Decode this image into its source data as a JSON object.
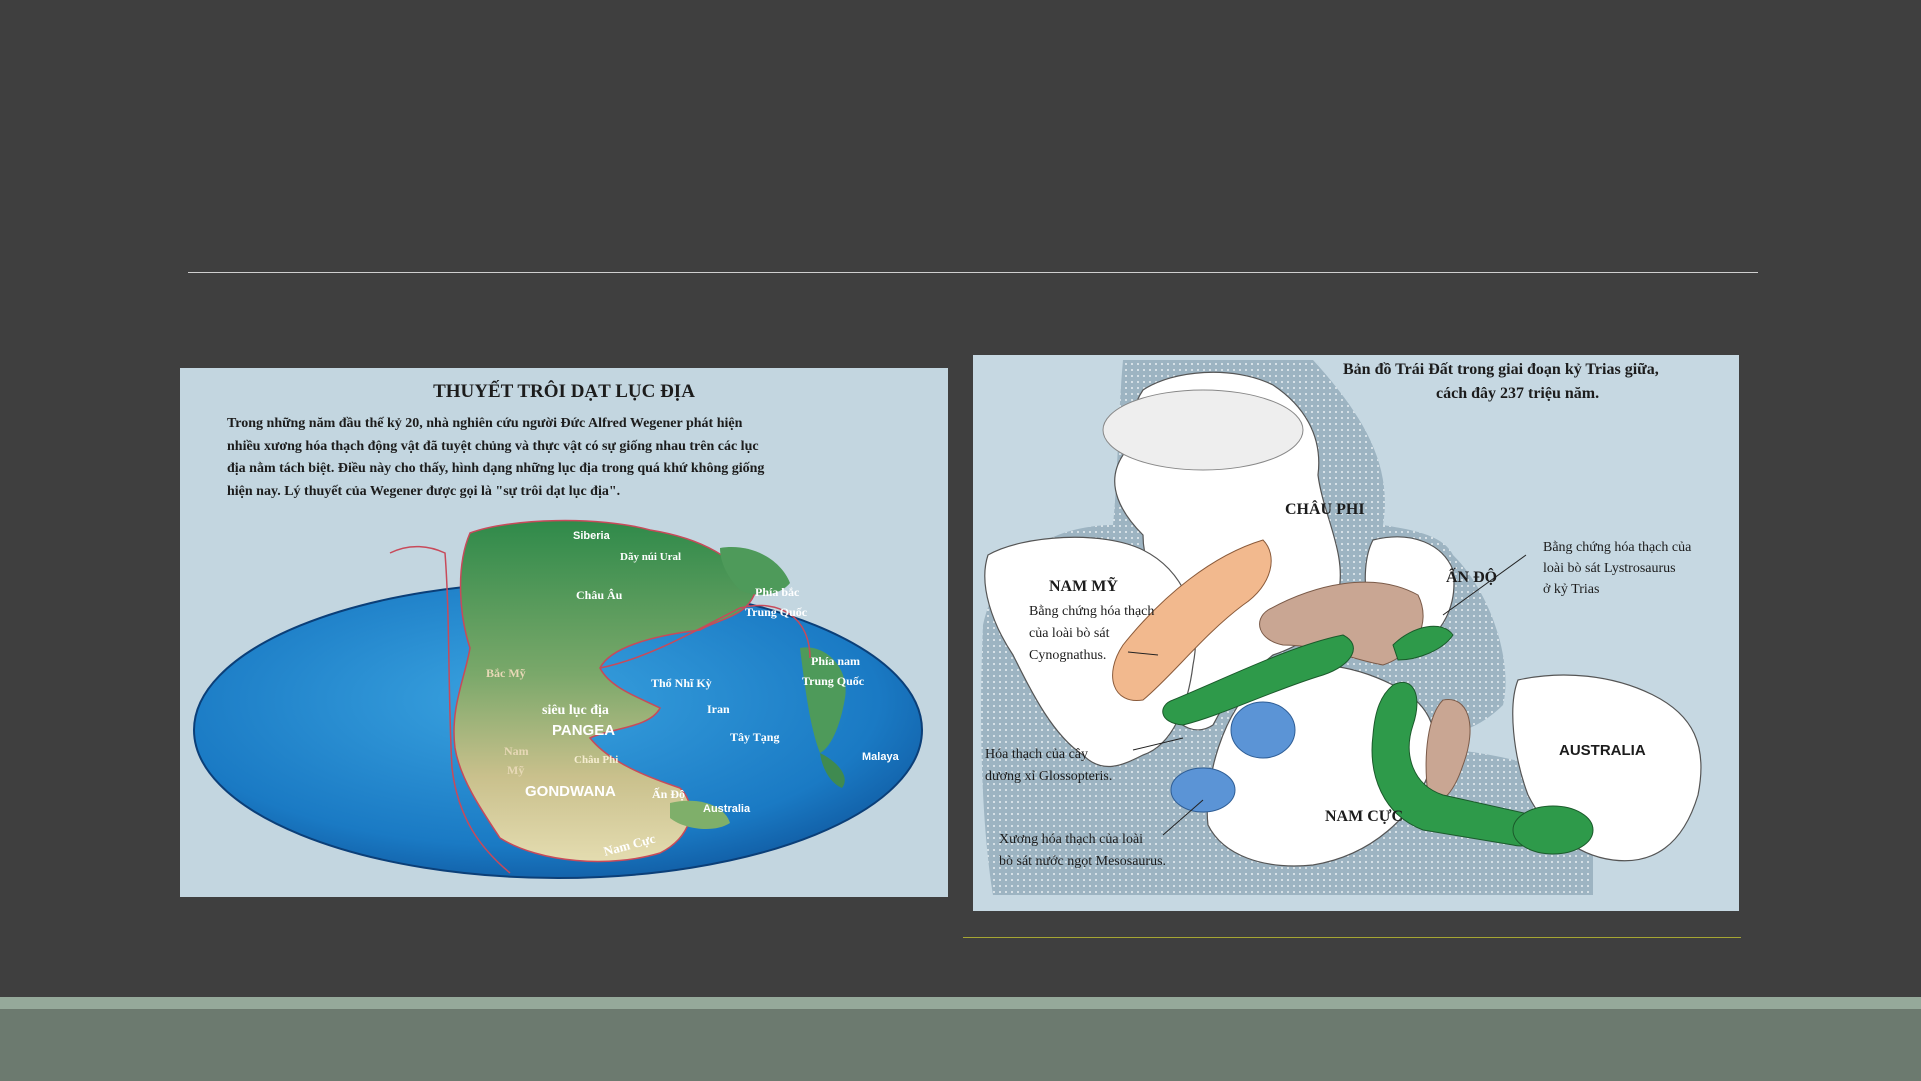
{
  "left_figure": {
    "title": "THUYẾT TRÔI DẠT LỤC ĐỊA",
    "paragraph_lines": [
      "Trong những năm đầu thế kỷ 20, nhà nghiên cứu người Đức Alfred Wegener phát hiện",
      "nhiều xương hóa thạch động vật đã tuyệt chủng và thực vật có sự giống nhau trên các lục",
      "địa nằm tách biệt. Điều này cho thấy, hình dạng những lục địa trong quá khứ không giống",
      "hiện nay. Lý thuyết của Wegener được gọi là \"sự trôi dạt lục địa\"."
    ],
    "labels": {
      "siberia": "Siberia",
      "ural": "Dãy núi Ural",
      "europe": "Châu Âu",
      "north_china_1": "Phía bắc",
      "north_china_2": "Trung Quốc",
      "north_america": "Bắc Mỹ",
      "turkey": "Thổ Nhĩ Kỳ",
      "south_china_1": "Phía nam",
      "south_china_2": "Trung Quốc",
      "iran": "Iran",
      "super_continent": "siêu lục địa",
      "pangea": "PANGEA",
      "tibet": "Tây Tạng",
      "malaya": "Malaya",
      "south_america_1": "Nam",
      "south_america_2": "Mỹ",
      "africa": "Châu Phi",
      "gondwana": "GONDWANA",
      "india": "Ấn Độ",
      "australia": "Australia",
      "antarctica": "Nam Cực"
    }
  },
  "right_figure": {
    "title_line_1": "Bản đồ Trái Đất trong giai đoạn kỷ Trias giữa,",
    "title_line_2": "cách đây 237 triệu năm.",
    "labels": {
      "africa": "CHÂU PHI",
      "south_america": "NAM MỸ",
      "india": "ẤN ĐỘ",
      "antarctica": "NAM CỰC",
      "australia": "AUSTRALIA"
    },
    "annotations": {
      "cynognathus_1": "Bằng chứng hóa thạch",
      "cynognathus_2": "của loài bò sát",
      "cynognathus_3": "Cynognathus.",
      "lystrosaurus_1": "Bằng chứng hóa thạch của",
      "lystrosaurus_2": "loài bò sát Lystrosaurus",
      "lystrosaurus_3": "ở kỷ Trias",
      "glossopteris_1": "Hóa thạch của cây",
      "glossopteris_2": "dương xỉ Glossopteris.",
      "mesosaurus_1": "Xương hóa thạch của loài",
      "mesosaurus_2": "bò sát nước ngọt Mesosaurus."
    }
  },
  "colors": {
    "background": "#3f3f3f",
    "footer": "#6c7a6f",
    "cynognathus": "#f2b98e",
    "lystrosaurus": "#c9a693",
    "glossopteris": "#2e9a4a",
    "mesosaurus": "#5b94d6"
  }
}
